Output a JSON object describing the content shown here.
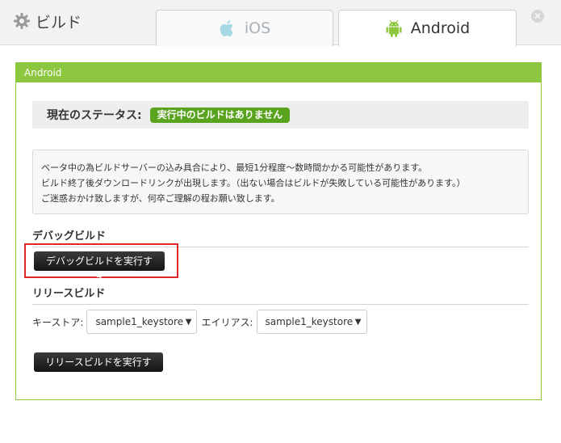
{
  "header": {
    "title": "ビルド",
    "title_icon": "gear-icon"
  },
  "tabs": [
    {
      "label": "iOS",
      "icon": "apple-icon",
      "active": false
    },
    {
      "label": "Android",
      "icon": "android-icon",
      "active": true
    }
  ],
  "close_icon": "close-icon",
  "panel": {
    "title": "Android",
    "status": {
      "label": "現在のステータス:",
      "badge": "実行中のビルドはありません"
    },
    "notice": [
      "ベータ中の為ビルドサーバーの込み具合により、最短1分程度〜数時間かかる可能性があります。",
      "ビルド終了後ダウンロードリンクが出現します。（出ない場合はビルドが失敗している可能性があります。）",
      "ご迷惑おかけ致しますが、何卒ご理解の程お願い致します。"
    ],
    "debug": {
      "section_title": "デバッグビルド",
      "button": "デバッグビルドを実行する"
    },
    "release": {
      "section_title": "リリースビルド",
      "keystore_label": "キーストア:",
      "keystore_value": "sample1_keystore",
      "alias_label": "エイリアス:",
      "alias_value": "sample1_keystore",
      "button": "リリースビルドを実行する"
    }
  },
  "colors": {
    "accent_green": "#8dc63f",
    "badge_green": "#5aa31f",
    "highlight_red": "#e0262b",
    "ios_gray": "#aab2b8",
    "android_green": "#8dc63f"
  }
}
